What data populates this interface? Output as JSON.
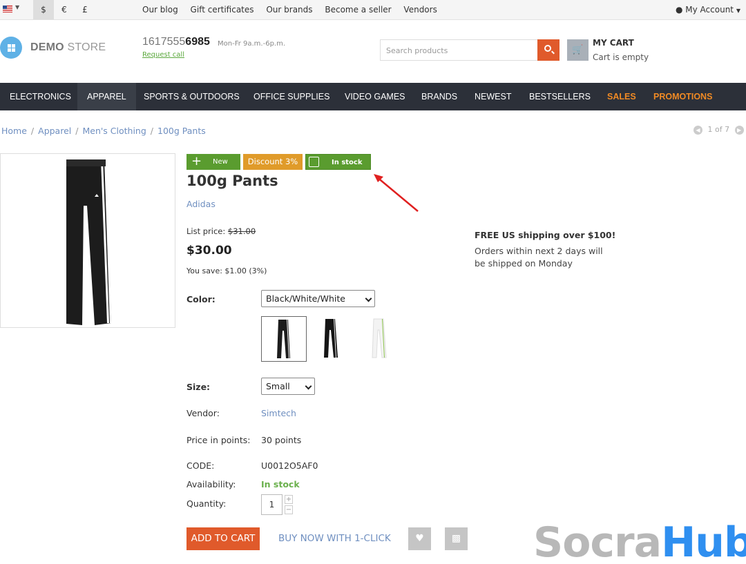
{
  "topbar": {
    "currencies": [
      "$",
      "€",
      "£"
    ],
    "links": [
      "Our blog",
      "Gift certificates",
      "Our brands",
      "Become a seller",
      "Vendors"
    ],
    "account": "My Account"
  },
  "header": {
    "logo_part1": "DEMO",
    "logo_part2": "STORE",
    "phone_prefix": "1617555",
    "phone_bold": "6985",
    "hours": "Mon-Fr 9a.m.-6p.m.",
    "request_call": "Request call",
    "search_placeholder": "Search products",
    "cart_title": "MY CART",
    "cart_status": "Cart is empty"
  },
  "nav": [
    "ELECTRONICS",
    "APPAREL",
    "SPORTS & OUTDOORS",
    "OFFICE SUPPLIES",
    "VIDEO GAMES",
    "BRANDS",
    "NEWEST",
    "BESTSELLERS",
    "SALES",
    "PROMOTIONS"
  ],
  "breadcrumb": {
    "items": [
      "Home",
      "Apparel",
      "Men's Clothing",
      "100g Pants"
    ],
    "separator": "/",
    "pager": "1 of 7"
  },
  "product": {
    "badges": {
      "new": "New",
      "discount": "Discount 3%",
      "stock": "In stock"
    },
    "title": "100g Pants",
    "brand": "Adidas",
    "list_price_label": "List price:",
    "list_price": "$31.00",
    "price": "$30.00",
    "you_save": "You save: $1.00 (3%)",
    "shipping_title": "FREE US shipping over $100!",
    "shipping_text": "Orders within next 2 days will be shipped on Monday",
    "color_label": "Color:",
    "color_value": "Black/White/White",
    "size_label": "Size:",
    "size_value": "Small",
    "vendor_label": "Vendor:",
    "vendor_value": "Simtech",
    "points_label": "Price in points:",
    "points_value": "30 points",
    "code_label": "CODE:",
    "code_value": "U0012O5AF0",
    "availability_label": "Availability:",
    "availability_value": "In stock",
    "quantity_label": "Quantity:",
    "quantity_value": "1",
    "add_to_cart": "ADD TO CART",
    "buy_now": "BUY NOW WITH 1-CLICK"
  },
  "watermark": {
    "part1": "Socra",
    "part2": "Hub"
  },
  "colors": {
    "accent": "#e05a2b",
    "nav_bg": "#2c3039",
    "green": "#5a9c2f",
    "orange": "#f08a24",
    "link": "#6f8fc0"
  }
}
